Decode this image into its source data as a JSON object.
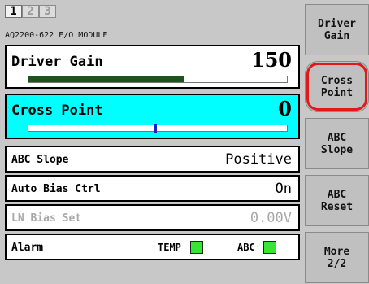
{
  "tabs": [
    "1",
    "2",
    "3"
  ],
  "module_title": "AQ2200-622 E/O MODULE",
  "rows": {
    "driver_gain": {
      "label": "Driver Gain",
      "value": "150",
      "bar_fraction": 0.6
    },
    "cross_point": {
      "label": "Cross Point",
      "value": "0",
      "marker_fraction": 0.5
    },
    "abc_slope": {
      "label": "ABC Slope",
      "value": "Positive"
    },
    "auto_bias": {
      "label": "Auto Bias Ctrl",
      "value": "On"
    },
    "ln_bias": {
      "label": "LN Bias Set",
      "value": "0.00V"
    },
    "alarm": {
      "label": "Alarm",
      "temp": "TEMP",
      "abc": "ABC"
    }
  },
  "softkeys": [
    {
      "line1": "Driver",
      "line2": "Gain"
    },
    {
      "line1": "Cross",
      "line2": "Point"
    },
    {
      "line1": "ABC",
      "line2": "Slope"
    },
    {
      "line1": "ABC",
      "line2": "Reset"
    },
    {
      "line1": "More",
      "line2": "2/2"
    }
  ],
  "colors": {
    "selected_row": "#00ffff",
    "gain_bar": "#1d531d",
    "marker": "#1a22c8",
    "alarm_ok": "#36e633",
    "highlight": "#e01a1a"
  }
}
